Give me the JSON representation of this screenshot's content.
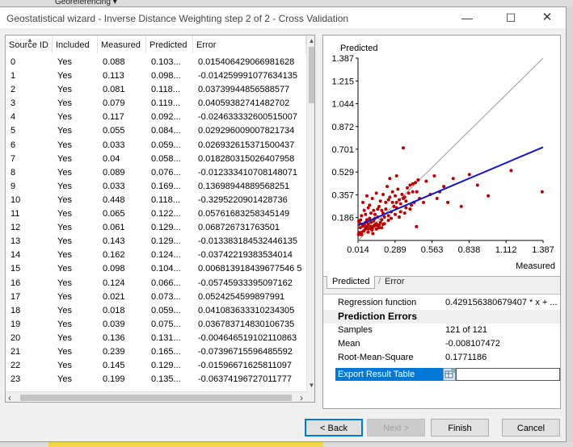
{
  "background_app": {
    "menu": "Georeferencing ▾"
  },
  "window": {
    "title": "Geostatistical wizard - Inverse Distance Weighting step 2 of 2 - Cross Validation"
  },
  "table": {
    "columns": [
      "Source ID",
      "Included",
      "Measured",
      "Predicted",
      "Error"
    ],
    "rows": [
      [
        "0",
        "Yes",
        "0.088",
        "0.103...",
        "0.015406429066981628"
      ],
      [
        "1",
        "Yes",
        "0.113",
        "0.098...",
        "-0.014259991077634135"
      ],
      [
        "2",
        "Yes",
        "0.081",
        "0.118...",
        "0.03739944856588577"
      ],
      [
        "3",
        "Yes",
        "0.079",
        "0.119...",
        "0.04059382741482702"
      ],
      [
        "4",
        "Yes",
        "0.117",
        "0.092...",
        "-0.024633332600515007"
      ],
      [
        "5",
        "Yes",
        "0.055",
        "0.084...",
        "0.029296009007821734"
      ],
      [
        "6",
        "Yes",
        "0.033",
        "0.059...",
        "0.026932615371500437"
      ],
      [
        "7",
        "Yes",
        "0.04",
        "0.058...",
        "0.018280315026407958"
      ],
      [
        "8",
        "Yes",
        "0.089",
        "0.076...",
        "-0.012333410708148071"
      ],
      [
        "9",
        "Yes",
        "0.033",
        "0.169...",
        "0.13698944889568251"
      ],
      [
        "10",
        "Yes",
        "0.448",
        "0.118...",
        "-0.3295220901428736"
      ],
      [
        "11",
        "Yes",
        "0.065",
        "0.122...",
        "0.05761683258345149"
      ],
      [
        "12",
        "Yes",
        "0.061",
        "0.129...",
        "0.068726731763501"
      ],
      [
        "13",
        "Yes",
        "0.143",
        "0.129...",
        "-0.013383184532446135"
      ],
      [
        "14",
        "Yes",
        "0.162",
        "0.124...",
        "-0.03742219383534014"
      ],
      [
        "15",
        "Yes",
        "0.098",
        "0.104...",
        "0.006813918439677546 5"
      ],
      [
        "16",
        "Yes",
        "0.124",
        "0.066...",
        "-0.05745933395097162"
      ],
      [
        "17",
        "Yes",
        "0.021",
        "0.073...",
        "0.0524254599897991"
      ],
      [
        "18",
        "Yes",
        "0.018",
        "0.059...",
        "0.041083633310234305"
      ],
      [
        "19",
        "Yes",
        "0.039",
        "0.075...",
        "0.036783714830106735"
      ],
      [
        "20",
        "Yes",
        "0.136",
        "0.131...",
        "-0.004646519102110863"
      ],
      [
        "21",
        "Yes",
        "0.239",
        "0.165...",
        "-0.07396715596485592"
      ],
      [
        "22",
        "Yes",
        "0.145",
        "0.129...",
        "-0.01596671625811097"
      ],
      [
        "23",
        "Yes",
        "0.199",
        "0.135...",
        "-0.06374196727011777"
      ]
    ]
  },
  "tabs": [
    "Predicted",
    "Error"
  ],
  "info": {
    "regression_label": "Regression function",
    "regression_value": "0.429156380679407 * x + ...",
    "section_label": "Prediction Errors",
    "count_label": "Samples",
    "count_value": "121 of 121",
    "mean_label": "Mean",
    "mean_value": "-0.008107472",
    "rms_label": "Root-Mean-Square",
    "rms_value": "0.1771186",
    "export_label": "Export Result Table"
  },
  "buttons": {
    "back": "< Back",
    "next": "Next >",
    "finish": "Finish",
    "cancel": "Cancel"
  },
  "colors": {
    "points": "#b80000",
    "regression_line": "#1414c8",
    "reference_line": "#9a9a9a",
    "selection": "#0078d7"
  },
  "icons": {
    "minimize": "minimize-icon",
    "maximize": "maximize-icon",
    "close": "close-icon",
    "export": "table-export-icon"
  },
  "chart_data": {
    "type": "scatter",
    "title": "Predicted",
    "xlabel": "Measured",
    "ylabel": "Predicted",
    "xlim": [
      0.014,
      1.387
    ],
    "ylim": [
      0.014,
      1.387
    ],
    "x_ticks": [
      "0.014",
      "0.289",
      "0.563",
      "0.838",
      "1.112",
      "1.387"
    ],
    "y_ticks": [
      "0.186",
      "0.357",
      "0.529",
      "0.701",
      "0.872",
      "1.044",
      "1.215",
      "1.387"
    ],
    "regression": {
      "slope": 0.4291564,
      "intercept": 0.121
    },
    "reference_line": "1:1",
    "points": [
      [
        0.088,
        0.103
      ],
      [
        0.113,
        0.098
      ],
      [
        0.081,
        0.118
      ],
      [
        0.079,
        0.119
      ],
      [
        0.117,
        0.092
      ],
      [
        0.055,
        0.084
      ],
      [
        0.033,
        0.059
      ],
      [
        0.04,
        0.058
      ],
      [
        0.089,
        0.076
      ],
      [
        0.033,
        0.169
      ],
      [
        0.448,
        0.118
      ],
      [
        0.065,
        0.122
      ],
      [
        0.061,
        0.129
      ],
      [
        0.143,
        0.129
      ],
      [
        0.162,
        0.124
      ],
      [
        0.098,
        0.104
      ],
      [
        0.124,
        0.066
      ],
      [
        0.021,
        0.073
      ],
      [
        0.018,
        0.059
      ],
      [
        0.039,
        0.075
      ],
      [
        0.136,
        0.131
      ],
      [
        0.239,
        0.165
      ],
      [
        0.145,
        0.129
      ],
      [
        0.199,
        0.135
      ],
      [
        0.03,
        0.11
      ],
      [
        0.05,
        0.13
      ],
      [
        0.07,
        0.15
      ],
      [
        0.09,
        0.14
      ],
      [
        0.11,
        0.12
      ],
      [
        0.13,
        0.16
      ],
      [
        0.15,
        0.14
      ],
      [
        0.17,
        0.11
      ],
      [
        0.19,
        0.17
      ],
      [
        0.21,
        0.19
      ],
      [
        0.06,
        0.09
      ],
      [
        0.08,
        0.17
      ],
      [
        0.1,
        0.18
      ],
      [
        0.12,
        0.1
      ],
      [
        0.14,
        0.21
      ],
      [
        0.16,
        0.19
      ],
      [
        0.18,
        0.15
      ],
      [
        0.2,
        0.22
      ],
      [
        0.22,
        0.25
      ],
      [
        0.24,
        0.2
      ],
      [
        0.26,
        0.23
      ],
      [
        0.28,
        0.27
      ],
      [
        0.3,
        0.3
      ],
      [
        0.32,
        0.32
      ],
      [
        0.34,
        0.36
      ],
      [
        0.36,
        0.34
      ],
      [
        0.38,
        0.41
      ],
      [
        0.4,
        0.43
      ],
      [
        0.42,
        0.38
      ],
      [
        0.44,
        0.45
      ],
      [
        0.46,
        0.47
      ],
      [
        0.05,
        0.3
      ],
      [
        0.08,
        0.35
      ],
      [
        0.12,
        0.33
      ],
      [
        0.15,
        0.37
      ],
      [
        0.18,
        0.31
      ],
      [
        0.1,
        0.28
      ],
      [
        0.2,
        0.36
      ],
      [
        0.23,
        0.42
      ],
      [
        0.25,
        0.34
      ],
      [
        0.27,
        0.38
      ],
      [
        0.29,
        0.35
      ],
      [
        0.31,
        0.4
      ],
      [
        0.33,
        0.29
      ],
      [
        0.35,
        0.33
      ],
      [
        0.37,
        0.31
      ],
      [
        0.39,
        0.37
      ],
      [
        0.06,
        0.24
      ],
      [
        0.09,
        0.26
      ],
      [
        0.13,
        0.24
      ],
      [
        0.17,
        0.27
      ],
      [
        0.19,
        0.24
      ],
      [
        0.22,
        0.3
      ],
      [
        0.24,
        0.32
      ],
      [
        0.27,
        0.3
      ],
      [
        0.3,
        0.26
      ],
      [
        0.33,
        0.23
      ],
      [
        0.36,
        0.22
      ],
      [
        0.4,
        0.25
      ],
      [
        0.43,
        0.3
      ],
      [
        0.47,
        0.33
      ],
      [
        0.5,
        0.3
      ],
      [
        0.55,
        0.36
      ],
      [
        0.6,
        0.33
      ],
      [
        0.65,
        0.42
      ],
      [
        0.72,
        0.48
      ],
      [
        0.78,
        0.27
      ],
      [
        0.9,
        0.43
      ],
      [
        0.35,
        0.71
      ],
      [
        0.3,
        0.5
      ],
      [
        0.25,
        0.48
      ],
      [
        0.42,
        0.44
      ],
      [
        0.45,
        0.38
      ],
      [
        0.52,
        0.46
      ],
      [
        0.58,
        0.5
      ],
      [
        0.62,
        0.38
      ],
      [
        0.68,
        0.3
      ],
      [
        0.84,
        0.51
      ],
      [
        0.98,
        0.35
      ],
      [
        1.15,
        0.54
      ],
      [
        1.38,
        0.38
      ],
      [
        0.04,
        0.2
      ],
      [
        0.07,
        0.21
      ],
      [
        0.11,
        0.22
      ],
      [
        0.14,
        0.18
      ],
      [
        0.16,
        0.25
      ],
      [
        0.21,
        0.14
      ],
      [
        0.26,
        0.18
      ],
      [
        0.29,
        0.21
      ],
      [
        0.32,
        0.19
      ],
      [
        0.37,
        0.26
      ],
      [
        0.41,
        0.28
      ],
      [
        0.02,
        0.16
      ],
      [
        0.03,
        0.14
      ],
      [
        0.05,
        0.12
      ],
      [
        0.07,
        0.1
      ],
      [
        0.09,
        0.13
      ],
      [
        0.11,
        0.15
      ],
      [
        0.13,
        0.12
      ],
      [
        0.15,
        0.1
      ],
      [
        0.17,
        0.13
      ],
      [
        0.19,
        0.11
      ]
    ]
  }
}
